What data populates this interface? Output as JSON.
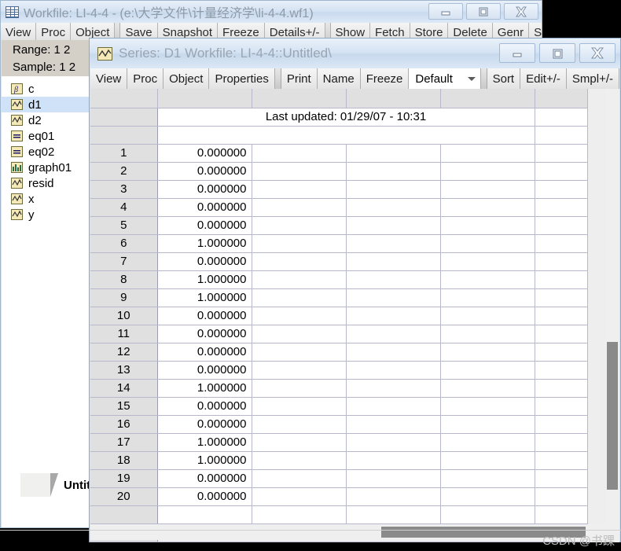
{
  "outer_window": {
    "title": "Workfile: LI-4-4 - (e:\\大学文件\\计量经济学\\li-4-4.wf1)",
    "icon": "workfile-grid-icon",
    "controls": {
      "minimize": "minimize-icon",
      "maximize": "maximize-icon",
      "close": "close-icon"
    },
    "toolbar": [
      {
        "label": "View",
        "type": "button"
      },
      {
        "label": "Proc",
        "type": "button"
      },
      {
        "label": "Object",
        "type": "button"
      },
      {
        "label": "",
        "type": "separator"
      },
      {
        "label": "Save",
        "type": "button"
      },
      {
        "label": "Snapshot",
        "type": "button"
      },
      {
        "label": "Freeze",
        "type": "button"
      },
      {
        "label": "Details+/-",
        "type": "button"
      },
      {
        "label": "",
        "type": "separator"
      },
      {
        "label": "Show",
        "type": "button"
      },
      {
        "label": "Fetch",
        "type": "button"
      },
      {
        "label": "Store",
        "type": "button"
      },
      {
        "label": "Delete",
        "type": "button"
      },
      {
        "label": "Genr",
        "type": "button"
      },
      {
        "label": "Sam",
        "type": "button"
      }
    ],
    "info": {
      "range_label": "Range:  1 2",
      "sample_label": "Sample: 1 2"
    },
    "objects": [
      {
        "label": "c",
        "icon": "coefficient-beta-icon",
        "selected": false
      },
      {
        "label": "d1",
        "icon": "series-icon",
        "selected": true
      },
      {
        "label": "d2",
        "icon": "series-icon",
        "selected": false
      },
      {
        "label": "eq01",
        "icon": "equation-icon",
        "selected": false
      },
      {
        "label": "eq02",
        "icon": "equation-icon",
        "selected": false
      },
      {
        "label": "graph01",
        "icon": "graph-bar-icon",
        "selected": false
      },
      {
        "label": "resid",
        "icon": "series-icon",
        "selected": false
      },
      {
        "label": "x",
        "icon": "series-icon",
        "selected": false
      },
      {
        "label": "y",
        "icon": "series-icon",
        "selected": false
      }
    ],
    "tab": {
      "label": "Untitle"
    }
  },
  "inner_window": {
    "title": "Series: D1   Workfile: LI-4-4::Untitled\\",
    "icon": "series-icon",
    "controls": {
      "minimize": "minimize-icon",
      "maximize": "maximize-icon",
      "close": "close-icon"
    },
    "toolbar": [
      {
        "label": "View",
        "type": "button"
      },
      {
        "label": "Proc",
        "type": "button"
      },
      {
        "label": "Object",
        "type": "button"
      },
      {
        "label": "Properties",
        "type": "button"
      },
      {
        "label": "",
        "type": "separator"
      },
      {
        "label": "Print",
        "type": "button"
      },
      {
        "label": "Name",
        "type": "button"
      },
      {
        "label": "Freeze",
        "type": "button"
      },
      {
        "label": "",
        "type": "combo"
      },
      {
        "label": "",
        "type": "separator"
      },
      {
        "label": "Sort",
        "type": "button"
      },
      {
        "label": "Edit+/-",
        "type": "button"
      },
      {
        "label": "Smpl+/-",
        "type": "button"
      }
    ],
    "view_select": {
      "value": "Default",
      "chevron": "chevron-down-icon"
    },
    "grid": {
      "last_updated": "Last updated: 01/29/07 - 10:31",
      "rows": [
        {
          "n": "1",
          "value": "0.000000"
        },
        {
          "n": "2",
          "value": "0.000000"
        },
        {
          "n": "3",
          "value": "0.000000"
        },
        {
          "n": "4",
          "value": "0.000000"
        },
        {
          "n": "5",
          "value": "0.000000"
        },
        {
          "n": "6",
          "value": "1.000000"
        },
        {
          "n": "7",
          "value": "0.000000"
        },
        {
          "n": "8",
          "value": "1.000000"
        },
        {
          "n": "9",
          "value": "1.000000"
        },
        {
          "n": "10",
          "value": "0.000000"
        },
        {
          "n": "11",
          "value": "0.000000"
        },
        {
          "n": "12",
          "value": "0.000000"
        },
        {
          "n": "13",
          "value": "0.000000"
        },
        {
          "n": "14",
          "value": "1.000000"
        },
        {
          "n": "15",
          "value": "0.000000"
        },
        {
          "n": "16",
          "value": "0.000000"
        },
        {
          "n": "17",
          "value": "1.000000"
        },
        {
          "n": "18",
          "value": "1.000000"
        },
        {
          "n": "19",
          "value": "0.000000"
        },
        {
          "n": "20",
          "value": "0.000000"
        }
      ]
    },
    "scrollbars": {
      "vertical": "vertical-scrollbar",
      "horizontal": "horizontal-scrollbar"
    }
  },
  "watermark": {
    "text": "CSDN @书踝"
  },
  "colors": {
    "titlebar_gradient_top": "#e9f1f9",
    "titlebar_gradient_bottom": "#dbe8f6",
    "selection": "#cfe2f7",
    "grid_header": "#e0e0e0",
    "grid_line": "#b8b8cc",
    "scroll_thumb": "#8a8a8a",
    "title_text": "#9aa5b2"
  }
}
